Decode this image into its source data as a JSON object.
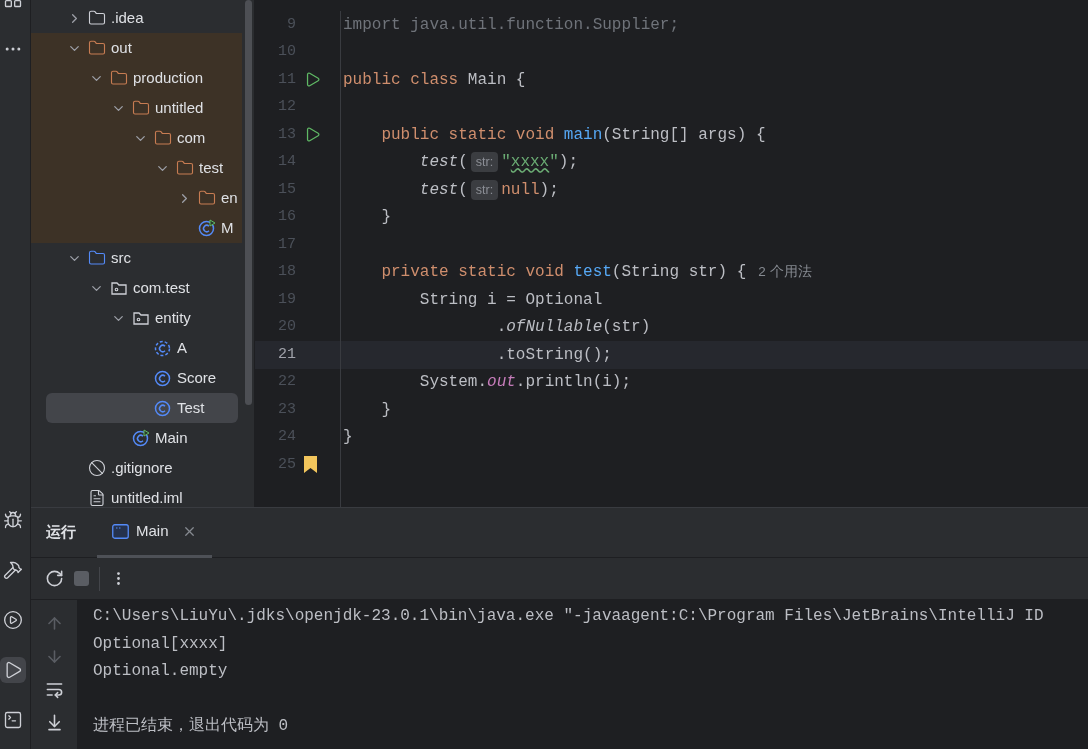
{
  "left_toolbar": {
    "top": [
      {
        "selected": false
      },
      {
        "selected": false
      }
    ],
    "bottom": [
      {
        "selected": false
      },
      {
        "selected": false
      },
      {
        "selected": false
      },
      {
        "selected": true
      },
      {
        "selected": false
      }
    ]
  },
  "project_tree": {
    "items": [
      {
        "label": ".idea",
        "kind": "folder",
        "expanded": false,
        "selected": false
      },
      {
        "label": "out",
        "kind": "excluded_folder",
        "expanded": true,
        "excluded": true,
        "selected": false,
        "children": [
          {
            "label": "production",
            "kind": "excluded_folder",
            "expanded": true,
            "selected": false,
            "children": [
              {
                "label": "untitled",
                "kind": "excluded_folder",
                "expanded": true,
                "selected": false,
                "children": [
                  {
                    "label": "com",
                    "kind": "excluded_folder",
                    "expanded": true,
                    "selected": false,
                    "children": [
                      {
                        "label": "test",
                        "kind": "excluded_folder",
                        "expanded": true,
                        "selected": false,
                        "children": [
                          {
                            "label": "en",
                            "kind": "excluded_folder",
                            "expanded": false,
                            "selected": false
                          },
                          {
                            "label": "M",
                            "kind": "runnable_class",
                            "selected": false
                          }
                        ]
                      }
                    ]
                  }
                ]
              }
            ]
          }
        ]
      },
      {
        "label": "src",
        "kind": "source_folder",
        "expanded": true,
        "selected": false,
        "children": [
          {
            "label": "com.test",
            "kind": "package",
            "expanded": true,
            "selected": false,
            "children": [
              {
                "label": "entity",
                "kind": "package",
                "expanded": true,
                "selected": false,
                "children": [
                  {
                    "label": "A",
                    "kind": "abstract_class",
                    "selected": false
                  },
                  {
                    "label": "Score",
                    "kind": "class",
                    "selected": false
                  },
                  {
                    "label": "Test",
                    "kind": "class",
                    "selected": true
                  }
                ]
              },
              {
                "label": "Main",
                "kind": "runnable_class",
                "selected": false
              }
            ]
          }
        ]
      },
      {
        "label": ".gitignore",
        "kind": "ignore_file",
        "selected": false
      },
      {
        "label": "untitled.iml",
        "kind": "module_file",
        "selected": false
      }
    ]
  },
  "editor": {
    "lines": [
      {
        "number": "9",
        "current": false,
        "kind": "plain",
        "segments": [
          {
            "kind": "unused",
            "text": "import java.util.function.Supplier;"
          }
        ]
      },
      {
        "number": "10",
        "current": false,
        "kind": "plain"
      },
      {
        "number": "11",
        "current": false,
        "kind": "run",
        "segments": [
          {
            "kind": "keyword",
            "text": "public class "
          },
          {
            "kind": "plain",
            "text": "Main {"
          }
        ]
      },
      {
        "number": "12",
        "current": false,
        "kind": "plain"
      },
      {
        "number": "13",
        "current": false,
        "kind": "run",
        "segments": [
          {
            "kind": "keyword",
            "text": "    public static void "
          },
          {
            "kind": "declaration",
            "text": "main"
          },
          {
            "kind": "plain",
            "text": "(String[] args) {"
          }
        ]
      },
      {
        "number": "14",
        "current": false,
        "kind": "plain",
        "segments": [
          {
            "kind": "italic",
            "text": "        test"
          },
          {
            "kind": "plain",
            "text": "("
          },
          {
            "kind": "hint",
            "text": "str:"
          },
          {
            "kind": "string",
            "text": "\""
          },
          {
            "kind": "typo",
            "text": "xxxx"
          },
          {
            "kind": "string",
            "text": "\""
          },
          {
            "kind": "plain",
            "text": ");"
          }
        ]
      },
      {
        "number": "15",
        "current": false,
        "kind": "plain",
        "segments": [
          {
            "kind": "italic",
            "text": "        test"
          },
          {
            "kind": "plain",
            "text": "("
          },
          {
            "kind": "hint",
            "text": "str:"
          },
          {
            "kind": "keyword",
            "text": "null"
          },
          {
            "kind": "plain",
            "text": ");"
          }
        ]
      },
      {
        "number": "16",
        "current": false,
        "kind": "plain",
        "segments": [
          {
            "kind": "plain",
            "text": "    }"
          }
        ]
      },
      {
        "number": "17",
        "current": false,
        "kind": "plain"
      },
      {
        "number": "18",
        "current": false,
        "kind": "plain",
        "segments": [
          {
            "kind": "keyword",
            "text": "    private static void "
          },
          {
            "kind": "declaration",
            "text": "test"
          },
          {
            "kind": "plain",
            "text": "(String str) {"
          },
          {
            "kind": "usages",
            "text": "2 个用法"
          }
        ]
      },
      {
        "number": "19",
        "current": false,
        "kind": "plain",
        "segments": [
          {
            "kind": "plain",
            "text": "        String i = Optional"
          }
        ]
      },
      {
        "number": "20",
        "current": false,
        "kind": "plain",
        "segments": [
          {
            "kind": "plain",
            "text": "                ."
          },
          {
            "kind": "italic",
            "text": "ofNullable"
          },
          {
            "kind": "plain",
            "text": "(str)"
          }
        ]
      },
      {
        "number": "21",
        "current": true,
        "kind": "plain",
        "segments": [
          {
            "kind": "plain",
            "text": "                .toString();"
          }
        ]
      },
      {
        "number": "22",
        "current": false,
        "kind": "plain",
        "segments": [
          {
            "kind": "plain",
            "text": "        System."
          },
          {
            "kind": "static_field",
            "text": "out"
          },
          {
            "kind": "plain",
            "text": ".println(i);"
          }
        ]
      },
      {
        "number": "23",
        "current": false,
        "kind": "plain",
        "segments": [
          {
            "kind": "plain",
            "text": "    }"
          }
        ]
      },
      {
        "number": "24",
        "current": false,
        "kind": "plain",
        "segments": [
          {
            "kind": "plain",
            "text": "}"
          }
        ]
      },
      {
        "number": "25",
        "current": false,
        "kind": "bookmark"
      }
    ]
  },
  "run_panel": {
    "title": "运行",
    "tabs": [
      {
        "label": "Main",
        "selected": true
      }
    ],
    "console": [
      {
        "kind": "command",
        "text": "C:\\Users\\LiuYu\\.jdks\\openjdk-23.0.1\\bin\\java.exe \"-javaagent:C:\\Program Files\\JetBrains\\IntelliJ ID"
      },
      {
        "kind": "output",
        "text": "Optional[xxxx]"
      },
      {
        "kind": "output",
        "text": "Optional.empty"
      },
      {
        "kind": "exit",
        "text": "进程已结束，退出代码为 0"
      }
    ]
  }
}
